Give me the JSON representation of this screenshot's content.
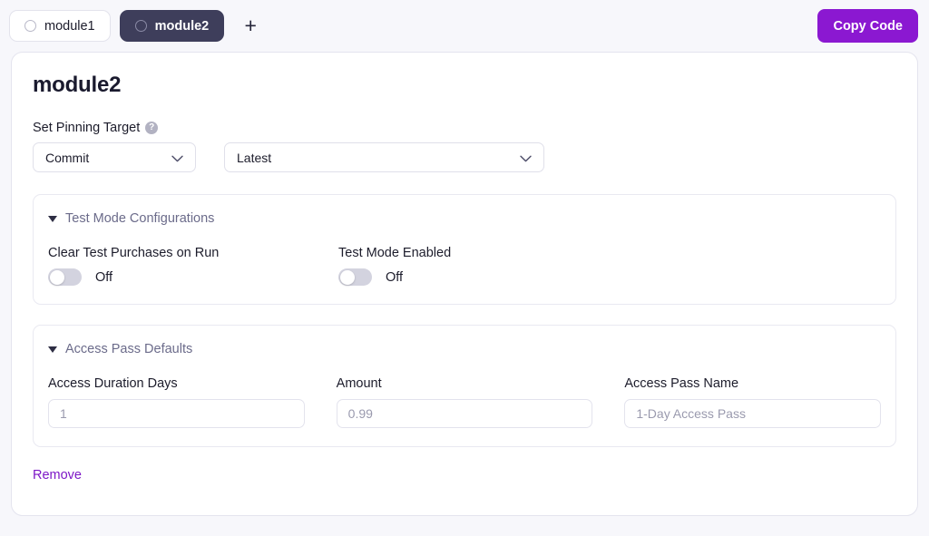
{
  "topbar": {
    "tabs": [
      {
        "label": "module1",
        "active": false
      },
      {
        "label": "module2",
        "active": true
      }
    ],
    "add_tab_label": "+",
    "copy_code_label": "Copy Code"
  },
  "card": {
    "title": "module2",
    "pinning": {
      "label": "Set Pinning Target",
      "help_icon": "help-circle-icon",
      "help_glyph": "?",
      "target_type": "Commit",
      "target_value": "Latest"
    },
    "sections": [
      {
        "title": "Test Mode Configurations",
        "caret": "caret-down-icon",
        "toggles": [
          {
            "label": "Clear Test Purchases on Run",
            "state": "Off",
            "on": false
          },
          {
            "label": "Test Mode Enabled",
            "state": "Off",
            "on": false
          }
        ]
      },
      {
        "title": "Access Pass Defaults",
        "caret": "caret-down-icon",
        "fields": [
          {
            "label": "Access Duration Days",
            "value": "",
            "placeholder": "1"
          },
          {
            "label": "Amount",
            "value": "",
            "placeholder": "0.99"
          },
          {
            "label": "Access Pass Name",
            "value": "",
            "placeholder": "1-Day Access Pass"
          }
        ]
      }
    ],
    "remove_label": "Remove"
  },
  "colors": {
    "accent_purple": "#8b18d1",
    "remove_purple": "#7d17c7",
    "active_tab": "#3e3e5b",
    "page_bg": "#f7f7fb",
    "section_title": "#6b6b8a"
  }
}
